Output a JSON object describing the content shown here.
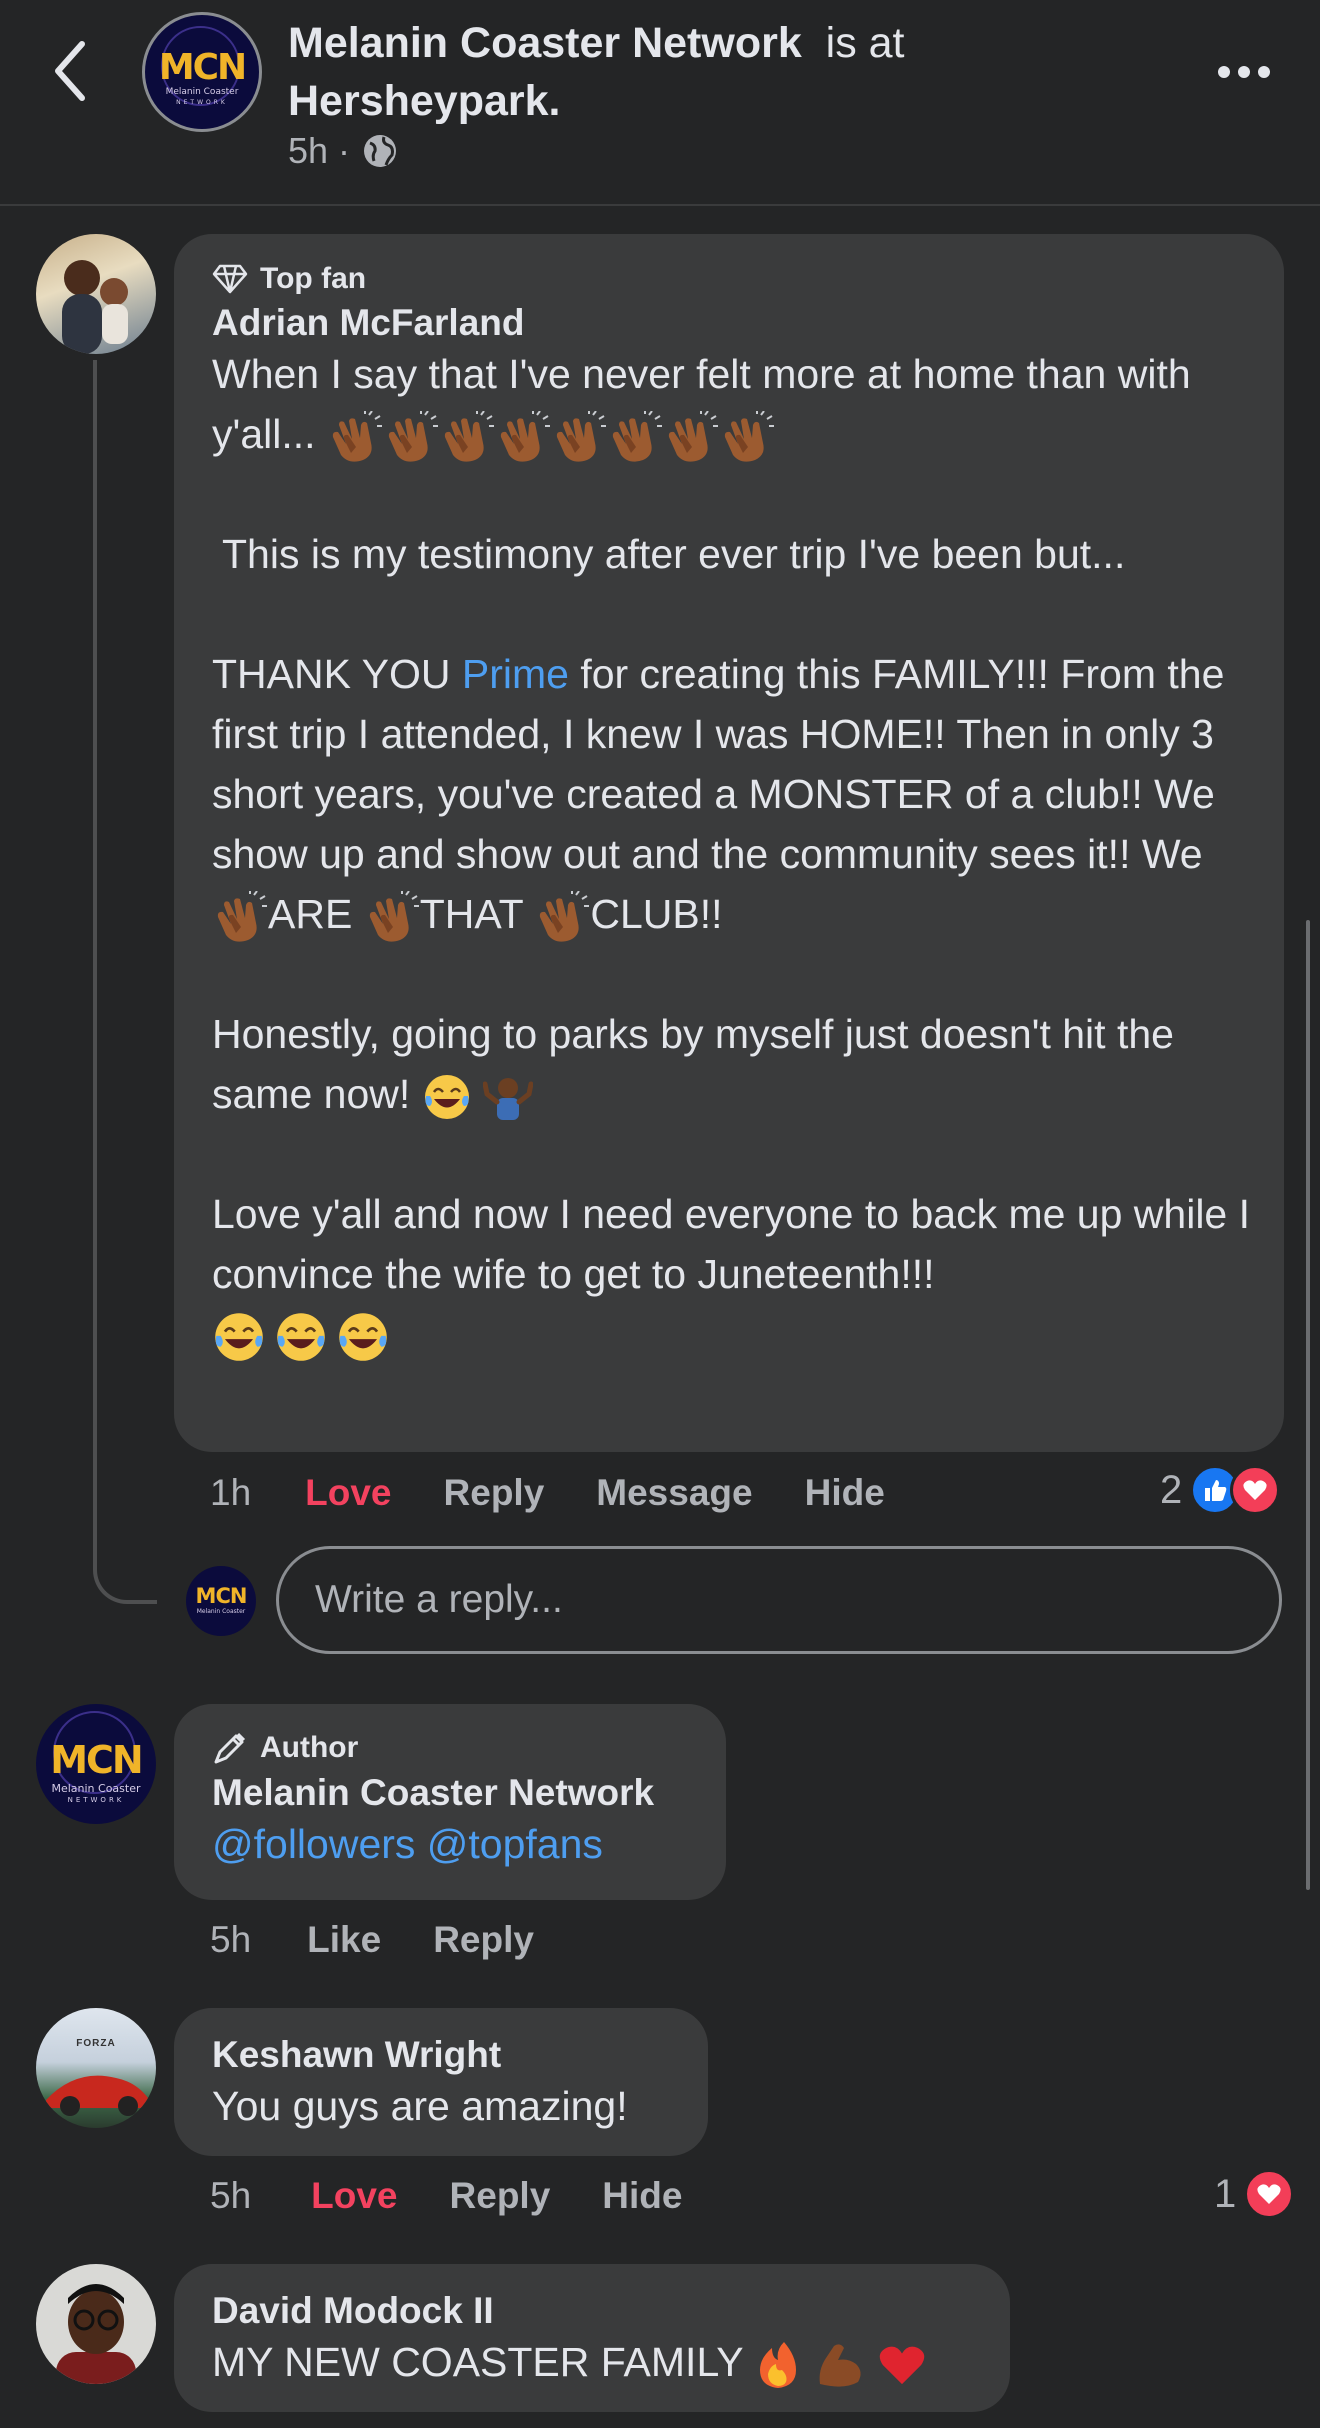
{
  "header": {
    "page_name": "Melanin Coaster Network",
    "is_at": "is at",
    "location": "Hersheypark.",
    "time": "5h",
    "separator": "·",
    "logo_text": "MCN",
    "logo_subtext": "Melanin Coaster",
    "logo_subtext2": "NETWORK"
  },
  "comments": [
    {
      "badge": "Top fan",
      "name": "Adrian McFarland",
      "p1": "When I say that I've never felt more at home than with y'all...",
      "p2": "This is my testimony after ever trip I've been but...",
      "p3_a": "THANK YOU ",
      "p3_link": "Prime",
      "p3_b": " for creating this FAMILY!!! From the first trip I attended, I knew I was HOME!! Then in only 3 short years, you've created a MONSTER of a club!! We show up and show out and the community sees it!! We",
      "p3_are": "ARE",
      "p3_that": "THAT",
      "p3_club": "CLUB!!",
      "p4": "Honestly, going to parks by myself just doesn't hit the same now!",
      "p5": "Love y'all and now I need everyone to back me up while I convince the wife to get to Juneteenth!!!",
      "time": "1h",
      "actions": [
        "Love",
        "Reply",
        "Message",
        "Hide"
      ],
      "reaction_count": "2"
    },
    {
      "badge": "Author",
      "name": "Melanin Coaster Network",
      "text_link": "@followers @topfans",
      "time": "5h",
      "actions": [
        "Like",
        "Reply"
      ]
    },
    {
      "name": "Keshawn Wright",
      "text": "You guys are amazing!",
      "time": "5h",
      "actions": [
        "Love",
        "Reply",
        "Hide"
      ],
      "reaction_count": "1",
      "avatar_text": "FORZA"
    },
    {
      "name": "David Modock II",
      "text": "MY NEW COASTER FAMILY"
    }
  ],
  "reply": {
    "placeholder": "Write a reply..."
  },
  "colors": {
    "background": "#242526",
    "bubble": "#3a3b3c",
    "love": "#f3425f",
    "link": "#4e9ef0",
    "like": "#1877f2"
  },
  "icons": [
    "back-chevron-icon",
    "globe-icon",
    "more-icon",
    "diamond-icon",
    "pen-icon",
    "clap-emoji",
    "laugh-emoji",
    "shrug-emoji",
    "fire-emoji",
    "muscle-emoji",
    "heart-emoji",
    "like-reaction-icon",
    "love-reaction-icon"
  ]
}
